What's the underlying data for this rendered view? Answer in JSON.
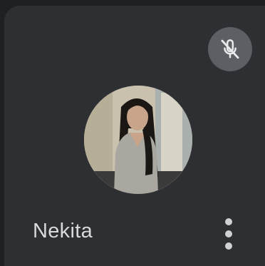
{
  "participant": {
    "name": "Nekita",
    "mic_state_icon": "mic-off-icon",
    "more_options_icon": "more-vert-icon"
  },
  "colors": {
    "tile_background": "#2d2f32",
    "mute_button_background": "#5c5f63",
    "name_text": "#d8dadd"
  }
}
